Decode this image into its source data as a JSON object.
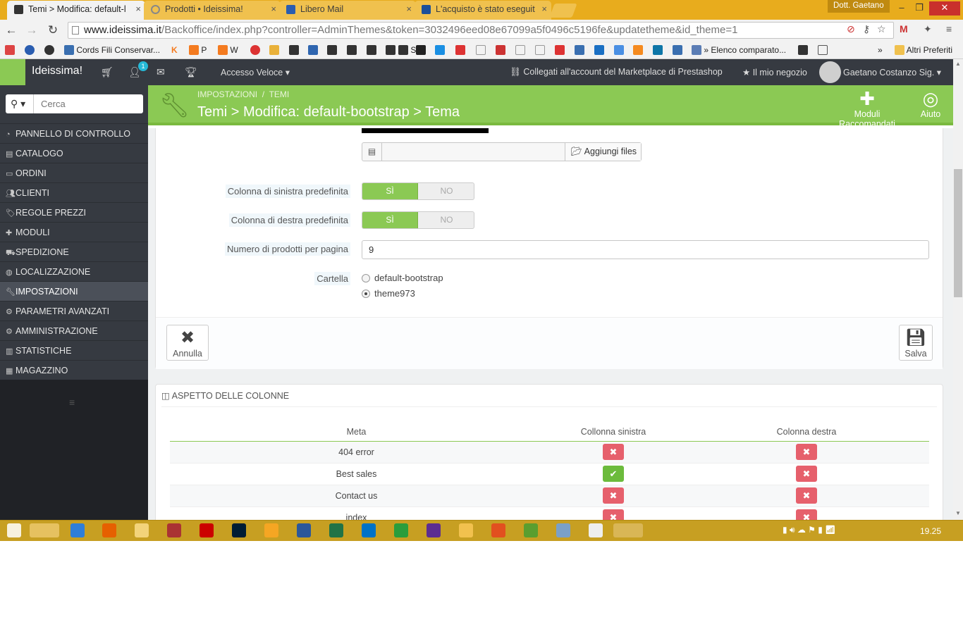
{
  "browser": {
    "tabs": [
      {
        "title": "Temi > Modifica: default-l",
        "active": true
      },
      {
        "title": "Prodotti • Ideissima!",
        "active": false
      },
      {
        "title": "Libero Mail",
        "active": false
      },
      {
        "title": "L'acquisto è stato eseguit",
        "active": false
      }
    ],
    "profile_name": "Dott. Gaetano",
    "url_host": "www.ideissima.it",
    "url_path": "/Backoffice/index.php?controller=AdminThemes&token=3032496eed08e67099a5f0496c5196fe&updatetheme&id_theme=1",
    "bookmarks": [
      "Cords Fili Conservar...",
      "P",
      "W",
      "S",
      "» Elenco comparato..."
    ],
    "other_bookmarks": "Altri Preferiti",
    "accent": "#e8ac1d"
  },
  "admin": {
    "shop_name": "Ideissima!",
    "notification_count": "1",
    "quick_access": "Accesso Veloce",
    "marketplace": "Collegati all'account del Marketplace di Prestashop",
    "my_shop": "Il mio negozio",
    "user": "Gaetano Costanzo Sig.",
    "brand_green": "#8bc954"
  },
  "sidebar": {
    "search_placeholder": "Cerca",
    "items": [
      {
        "label": "PANNELLO DI CONTROLLO",
        "icon": "dashboard-icon"
      },
      {
        "label": "CATALOGO",
        "icon": "book-icon"
      },
      {
        "label": "ORDINI",
        "icon": "credit-card-icon"
      },
      {
        "label": "CLIENTI",
        "icon": "users-icon"
      },
      {
        "label": "REGOLE PREZZI",
        "icon": "tags-icon"
      },
      {
        "label": "MODULI",
        "icon": "puzzle-icon"
      },
      {
        "label": "SPEDIZIONE",
        "icon": "truck-icon"
      },
      {
        "label": "LOCALIZZAZIONE",
        "icon": "globe-icon"
      },
      {
        "label": "IMPOSTAZIONI",
        "icon": "wrench-icon",
        "active": true
      },
      {
        "label": "PARAMETRI AVANZATI",
        "icon": "cogs-icon"
      },
      {
        "label": "AMMINISTRAZIONE",
        "icon": "cog-icon"
      },
      {
        "label": "STATISTICHE",
        "icon": "bar-chart-icon"
      },
      {
        "label": "MAGAZZINO",
        "icon": "archive-icon"
      }
    ]
  },
  "page": {
    "breadcrumb_1": "IMPOSTAZIONI",
    "breadcrumb_sep": "/",
    "breadcrumb_2": "TEMI",
    "title": "Temi > Modifica: default-bootstrap > Tema",
    "btn_modules": "Moduli Raccomandati",
    "btn_help": "Aiuto"
  },
  "form": {
    "add_files": "Aggiungi files",
    "left_col_label": "Colonna di sinistra predefinita",
    "right_col_label": "Colonna di destra predefinita",
    "yes": "SÌ",
    "no": "NO",
    "left_col_value": "SÌ",
    "right_col_value": "SÌ",
    "per_page_label": "Numero di prodotti per pagina",
    "per_page_value": "9",
    "folder_label": "Cartella",
    "folders": [
      "default-bootstrap",
      "theme973"
    ],
    "folder_selected": "theme973",
    "cancel": "Annulla",
    "save": "Salva"
  },
  "columns": {
    "title": "ASPETTO DELLE COLONNE",
    "headers": [
      "Meta",
      "Collonna sinistra",
      "Colonna destra"
    ],
    "rows": [
      {
        "meta": "404 error",
        "left": false,
        "right": false
      },
      {
        "meta": "Best sales",
        "left": true,
        "right": false
      },
      {
        "meta": "Contact us",
        "left": false,
        "right": false
      },
      {
        "meta": "index",
        "left": false,
        "right": false
      }
    ]
  },
  "taskbar": {
    "clock": "19.25"
  }
}
